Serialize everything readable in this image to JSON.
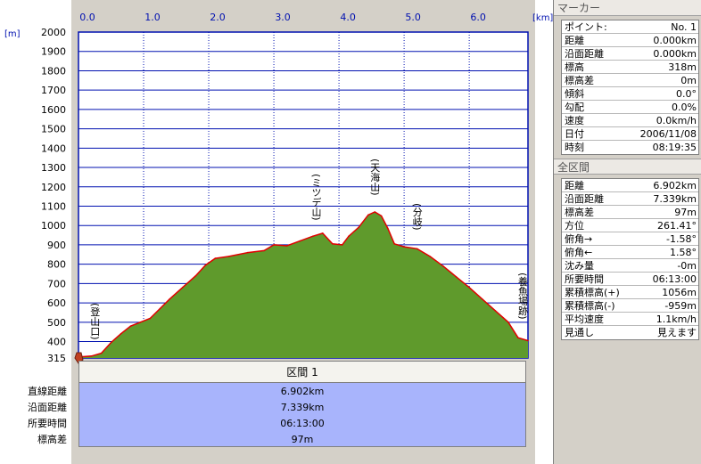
{
  "chart_data": {
    "type": "area",
    "title": "",
    "xlabel": "",
    "ylabel": "",
    "x_unit": "[km]",
    "y_unit": "[m]",
    "xlim": [
      0,
      6.902
    ],
    "ylim": [
      315,
      2000
    ],
    "x_ticks": [
      "0.0",
      "1.0",
      "2.0",
      "3.0",
      "4.0",
      "5.0",
      "6.0"
    ],
    "y_ticks": [
      "2000",
      "1900",
      "1800",
      "1700",
      "1600",
      "1500",
      "1400",
      "1300",
      "1200",
      "1100",
      "1000",
      "900",
      "800",
      "700",
      "600",
      "500",
      "400",
      "315"
    ],
    "grid": true,
    "fill_color": "#5f9a2c",
    "line_color": "#e00000",
    "plot_bg": "#ffffff",
    "grid_color": "#0010b0",
    "series": [
      {
        "x": [
          0.0,
          0.2,
          0.35,
          0.5,
          0.65,
          0.8,
          0.95,
          1.1,
          1.25,
          1.4,
          1.6,
          1.8,
          1.95,
          2.1,
          2.3,
          2.6,
          2.85,
          3.0,
          3.2,
          3.4,
          3.6,
          3.75,
          3.9,
          4.05,
          4.15,
          4.3,
          4.45,
          4.55,
          4.65,
          4.75,
          4.85,
          5.0,
          5.2,
          5.4,
          5.6,
          5.8,
          6.0,
          6.2,
          6.4,
          6.6,
          6.75,
          6.902
        ],
        "y": [
          320,
          325,
          340,
          395,
          440,
          480,
          500,
          520,
          570,
          620,
          680,
          740,
          795,
          830,
          840,
          860,
          870,
          900,
          895,
          920,
          945,
          960,
          905,
          900,
          945,
          990,
          1055,
          1070,
          1050,
          985,
          905,
          890,
          880,
          840,
          790,
          735,
          680,
          620,
          560,
          500,
          420,
          405
        ]
      }
    ],
    "annotations": [
      {
        "label": "(登山口)",
        "x": 0.25
      },
      {
        "label": "(ミツデ山)",
        "x": 3.65
      },
      {
        "label": "(天海山)",
        "x": 4.55
      },
      {
        "label": "(分岐)",
        "x": 5.2
      },
      {
        "label": "(養魚場跡)",
        "x": 6.902
      }
    ]
  },
  "section": {
    "header": "区間 1",
    "rows": [
      {
        "label": "直線距離",
        "value": "6.902km"
      },
      {
        "label": "沿面距離",
        "value": "7.339km"
      },
      {
        "label": "所要時間",
        "value": "06:13:00"
      },
      {
        "label": "標高差",
        "value": "97m"
      }
    ]
  },
  "marker_panel": {
    "title": "マーカー",
    "rows": [
      {
        "label": "ポイント:",
        "value": "No. 1"
      },
      {
        "label": "距離",
        "value": "0.000km"
      },
      {
        "label": "沿面距離",
        "value": "0.000km"
      },
      {
        "label": "標高",
        "value": "318m"
      },
      {
        "label": "標高差",
        "value": "0m"
      },
      {
        "label": "傾斜",
        "value": "0.0°"
      },
      {
        "label": "勾配",
        "value": "0.0%"
      },
      {
        "label": "速度",
        "value": "0.0km/h"
      },
      {
        "label": "日付",
        "value": "2006/11/08"
      },
      {
        "label": "時刻",
        "value": "08:19:35"
      }
    ]
  },
  "total_panel": {
    "title": "全区間",
    "rows": [
      {
        "label": "距離",
        "value": "6.902km"
      },
      {
        "label": "沿面距離",
        "value": "7.339km"
      },
      {
        "label": "標高差",
        "value": "97m"
      },
      {
        "label": "方位",
        "value": "261.41°"
      },
      {
        "label": "俯角→",
        "value": "-1.58°"
      },
      {
        "label": "俯角←",
        "value": "1.58°"
      },
      {
        "label": "沈み量",
        "value": "-0m"
      },
      {
        "label": "所要時間",
        "value": "06:13:00"
      },
      {
        "label": "累積標高(+)",
        "value": "1056m"
      },
      {
        "label": "累積標高(-)",
        "value": "-959m"
      },
      {
        "label": "平均速度",
        "value": "1.1km/h"
      },
      {
        "label": "見通し",
        "value": "見えます"
      }
    ]
  }
}
